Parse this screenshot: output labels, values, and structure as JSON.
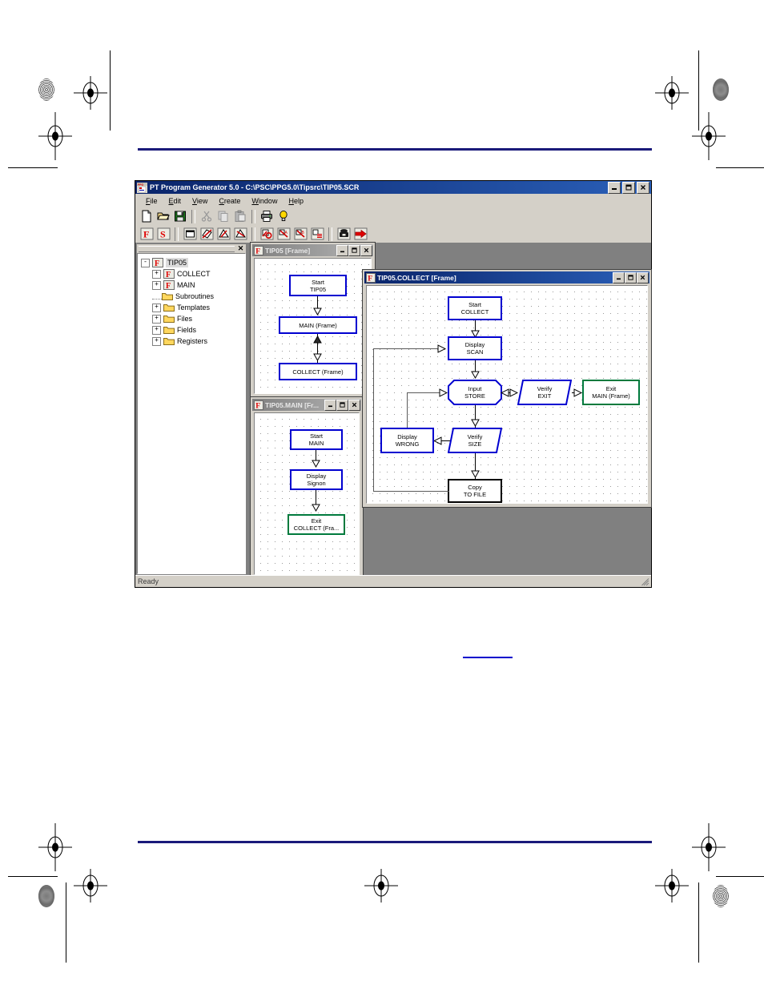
{
  "app": {
    "title": "PT Program Generator 5.0 - C:\\PSC\\PPG5.0\\Tipsrc\\TIP05.SCR",
    "icon": "ppg-app-icon",
    "window_buttons": {
      "minimize": "_",
      "maximize": "□",
      "close": "✕"
    },
    "status": "Ready"
  },
  "menubar": {
    "items": [
      {
        "label": "File",
        "accel": "F"
      },
      {
        "label": "Edit",
        "accel": "E"
      },
      {
        "label": "View",
        "accel": "V"
      },
      {
        "label": "Create",
        "accel": "C"
      },
      {
        "label": "Window",
        "accel": "W"
      },
      {
        "label": "Help",
        "accel": "H"
      }
    ]
  },
  "toolbar_standard": {
    "buttons": [
      {
        "name": "new-icon",
        "tip": "New"
      },
      {
        "name": "open-icon",
        "tip": "Open"
      },
      {
        "name": "save-icon",
        "tip": "Save"
      },
      {
        "name": "cut-icon",
        "tip": "Cut"
      },
      {
        "name": "copy-icon",
        "tip": "Copy"
      },
      {
        "name": "paste-icon",
        "tip": "Paste"
      },
      {
        "name": "print-icon",
        "tip": "Print"
      },
      {
        "name": "help-icon",
        "tip": "About"
      }
    ]
  },
  "toolbar_objects": {
    "buttons": [
      {
        "name": "frame-icon",
        "tip": "Frame"
      },
      {
        "name": "subroutine-icon",
        "tip": "Subroutine"
      },
      {
        "name": "display-icon",
        "tip": "Display"
      },
      {
        "name": "input-icon",
        "tip": "Input"
      },
      {
        "name": "verify-icon",
        "tip": "Verify"
      },
      {
        "name": "calculate-icon",
        "tip": "Calculate"
      },
      {
        "name": "copy-object-icon",
        "tip": "Copy"
      },
      {
        "name": "move-a-icon",
        "tip": "Move A"
      },
      {
        "name": "move-b-icon",
        "tip": "Move B"
      },
      {
        "name": "append-icon",
        "tip": "Append"
      },
      {
        "name": "communications-icon",
        "tip": "Communications"
      },
      {
        "name": "exit-icon",
        "tip": "Exit"
      }
    ]
  },
  "tree_panel": {
    "close_label": "✕",
    "nodes": [
      {
        "label": "TIP05",
        "depth": 0,
        "expander": "-",
        "icon": "program-icon",
        "selected": true
      },
      {
        "label": "COLLECT",
        "depth": 1,
        "expander": "+",
        "icon": "program-icon",
        "selected": false
      },
      {
        "label": "MAIN",
        "depth": 1,
        "expander": "+",
        "icon": "program-icon",
        "selected": false
      },
      {
        "label": "Subroutines",
        "depth": 1,
        "expander": "",
        "icon": "folder-icon",
        "selected": false
      },
      {
        "label": "Templates",
        "depth": 1,
        "expander": "+",
        "icon": "folder-icon",
        "selected": false
      },
      {
        "label": "Files",
        "depth": 1,
        "expander": "+",
        "icon": "folder-icon",
        "selected": false
      },
      {
        "label": "Fields",
        "depth": 1,
        "expander": "+",
        "icon": "folder-icon",
        "selected": false
      },
      {
        "label": "Registers",
        "depth": 1,
        "expander": "+",
        "icon": "folder-icon",
        "selected": false
      }
    ]
  },
  "windows": {
    "frame": {
      "title": "TIP05 [Frame]",
      "active": false,
      "buttons": {
        "minimize": "_",
        "maximize": "□",
        "close": "✕"
      },
      "nodes": [
        {
          "id": "n1",
          "line1": "Start",
          "line2": "TIP05",
          "shape": "rect",
          "color": "blue"
        },
        {
          "id": "n2",
          "line1": "MAIN (Frame)",
          "line2": "",
          "shape": "rect",
          "color": "blue"
        },
        {
          "id": "n3",
          "line1": "COLLECT (Frame)",
          "line2": "",
          "shape": "rect",
          "color": "blue"
        }
      ]
    },
    "main": {
      "title": "TIP05.MAIN [Fr...",
      "active": false,
      "buttons": {
        "minimize": "_",
        "maximize": "□",
        "close": "✕"
      },
      "nodes": [
        {
          "id": "m1",
          "line1": "Start",
          "line2": "MAIN",
          "shape": "rect",
          "color": "blue"
        },
        {
          "id": "m2",
          "line1": "Display",
          "line2": "Signon",
          "shape": "rect",
          "color": "blue"
        },
        {
          "id": "m3",
          "line1": "Exit",
          "line2": "COLLECT (Fra...",
          "shape": "rect",
          "color": "green"
        }
      ]
    },
    "collect": {
      "title": "TIP05.COLLECT [Frame]",
      "active": true,
      "buttons": {
        "minimize": "_",
        "maximize": "□",
        "close": "✕"
      },
      "nodes": [
        {
          "id": "c1",
          "line1": "Start",
          "line2": "COLLECT",
          "shape": "rect",
          "color": "blue"
        },
        {
          "id": "c2",
          "line1": "Display",
          "line2": "SCAN",
          "shape": "rect",
          "color": "blue"
        },
        {
          "id": "c3",
          "line1": "Input",
          "line2": "STORE",
          "shape": "octagon",
          "color": "blue"
        },
        {
          "id": "c4",
          "line1": "Verify",
          "line2": "EXIT",
          "shape": "para",
          "color": "blue"
        },
        {
          "id": "c5",
          "line1": "Exit",
          "line2": "MAIN (Frame)",
          "shape": "rect",
          "color": "green"
        },
        {
          "id": "c6",
          "line1": "Display",
          "line2": "WRONG",
          "shape": "rect",
          "color": "blue"
        },
        {
          "id": "c7",
          "line1": "Verify",
          "line2": "SIZE",
          "shape": "para",
          "color": "blue"
        },
        {
          "id": "c8",
          "line1": "Copy",
          "line2": "TO FILE",
          "shape": "rect",
          "color": "black"
        }
      ]
    }
  },
  "colors": {
    "title_active_start": "#0a246a",
    "title_active_end": "#2a5fb8",
    "title_inactive_start": "#808080",
    "title_inactive_end": "#b5b5b5",
    "face": "#d4d0c8",
    "mdi_background": "#808080",
    "node_blue": "#0000d0",
    "node_green": "#007a3d",
    "node_black": "#000000",
    "page_rule": "#1a1a7a",
    "link_underline": "#0000cc"
  }
}
